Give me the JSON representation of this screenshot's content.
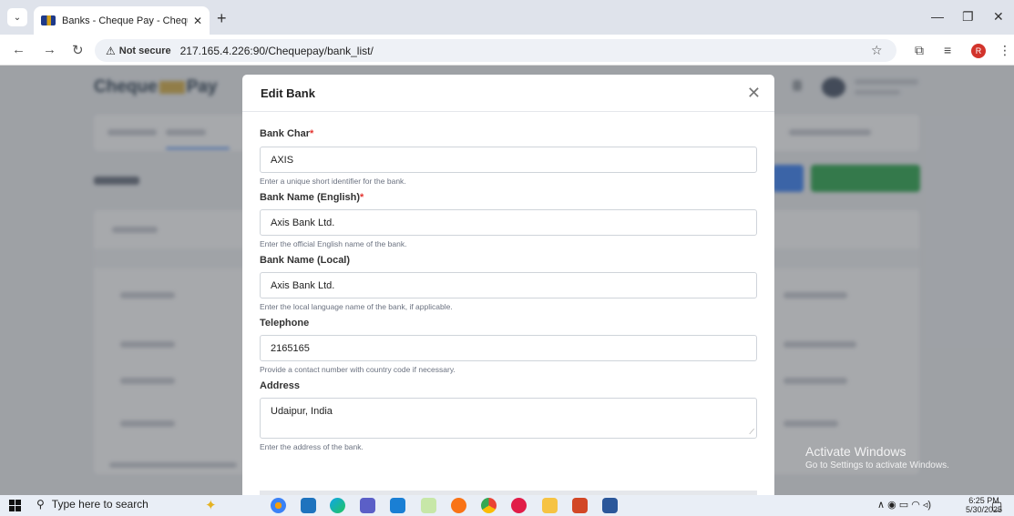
{
  "browser": {
    "tab_title": "Banks - Cheque Pay - Cheque P",
    "url_warning": "Not secure",
    "url": "217.165.4.226:90/Chequepay/bank_list/"
  },
  "app": {
    "logo_left": "Cheque",
    "logo_right": "Pay"
  },
  "modal": {
    "title": "Edit Bank",
    "fields": [
      {
        "label": "Bank Char",
        "required": "*",
        "value": "AXIS",
        "hint": "Enter a unique short identifier for the bank."
      },
      {
        "label": "Bank Name (English)",
        "required": "*",
        "value": "Axis Bank Ltd.",
        "hint": "Enter the official English name of the bank."
      },
      {
        "label": "Bank Name (Local)",
        "required": "",
        "value": "Axis Bank Ltd.",
        "hint": "Enter the local language name of the bank, if applicable."
      },
      {
        "label": "Telephone",
        "required": "",
        "value": "2165165",
        "hint": "Provide a contact number with country code if necessary."
      },
      {
        "label": "Address",
        "required": "",
        "value": "Udaipur, India",
        "hint": "Enter the address of the bank."
      }
    ]
  },
  "watermark": {
    "line1": "Activate Windows",
    "line2": "Go to Settings to activate Windows."
  },
  "taskbar": {
    "search_placeholder": "Type here to search",
    "time": "6:25 PM",
    "date": "5/30/2025"
  },
  "colors": {
    "required": "#e3342f",
    "primary_green": "#2fa84f",
    "primary_blue": "#3b82f6"
  }
}
